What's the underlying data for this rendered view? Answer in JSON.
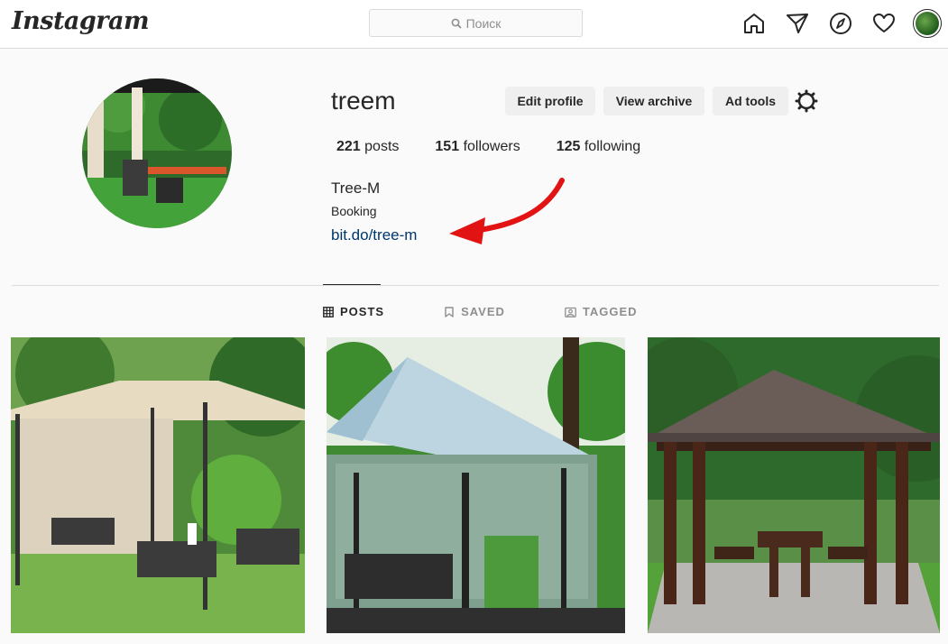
{
  "topnav": {
    "logo": "Instagram",
    "search": {
      "placeholder": "Поиск"
    },
    "icons": [
      "home-icon",
      "direct-icon",
      "explore-icon",
      "heart-icon",
      "profile-avatar"
    ]
  },
  "profile": {
    "username": "treem",
    "buttons": {
      "edit": "Edit profile",
      "archive": "View archive",
      "ad_tools": "Ad tools"
    },
    "stats": {
      "posts_count": "221",
      "posts_label": "posts",
      "followers_count": "151",
      "followers_label": "followers",
      "following_count": "125",
      "following_label": "following"
    },
    "full_name": "Tree-M",
    "category": "Booking",
    "link": "bit.do/tree-m"
  },
  "tabs": [
    {
      "label": "POSTS",
      "active": true
    },
    {
      "label": "SAVED",
      "active": false
    },
    {
      "label": "TAGGED",
      "active": false
    }
  ],
  "colors": {
    "link": "#00376b",
    "arrow": "#e21313",
    "text": "#262626",
    "muted": "#8e8e8e"
  }
}
